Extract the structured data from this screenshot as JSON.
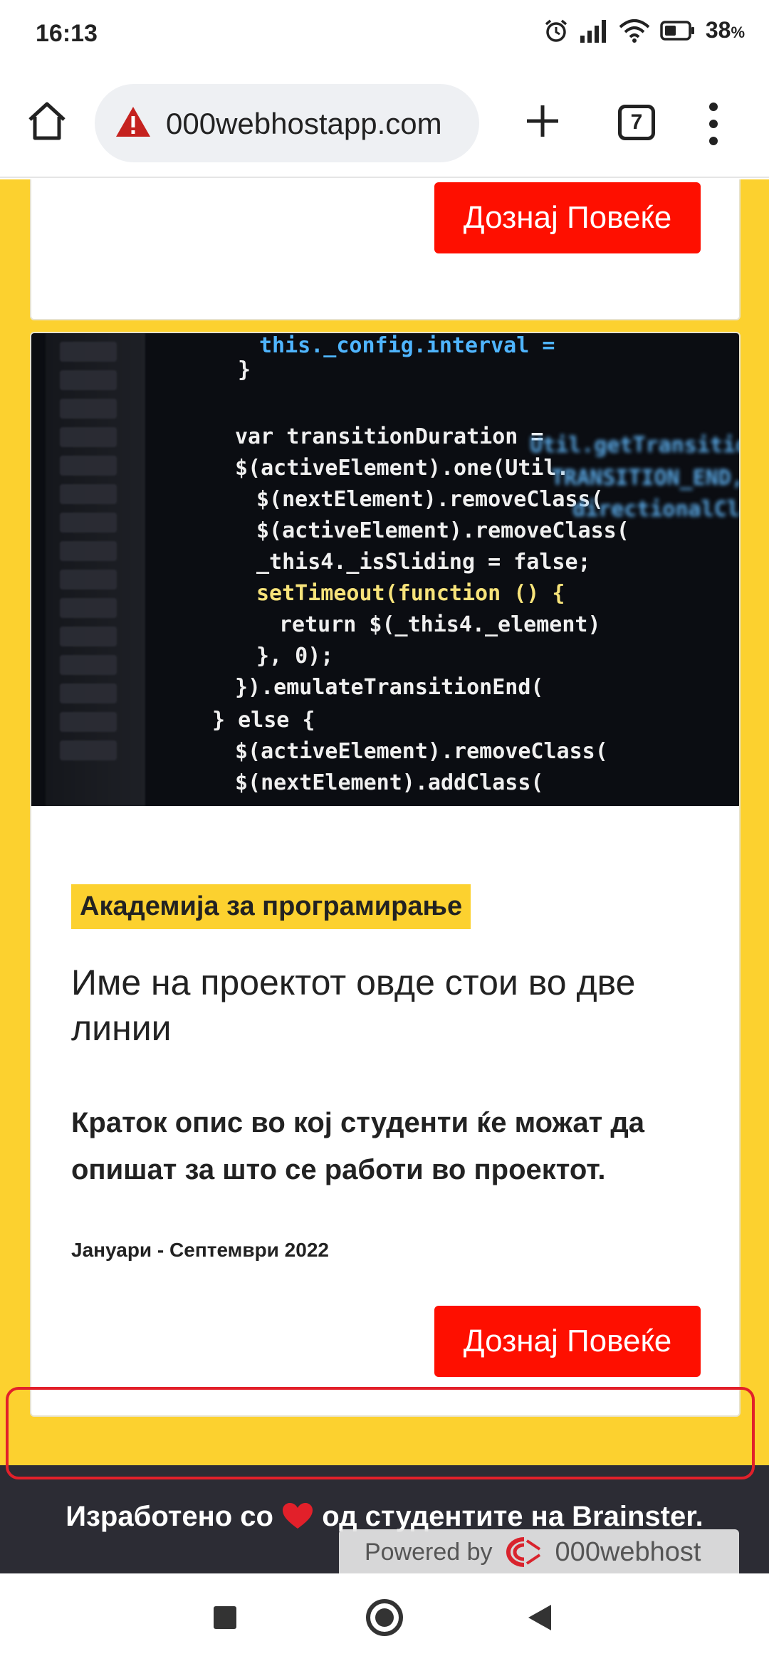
{
  "status": {
    "time": "16:13",
    "battery": "38",
    "battery_unit": "%"
  },
  "browser": {
    "url": "000webhostapp.com",
    "tab_count": "7"
  },
  "cards": {
    "top_button": "Дознај Повеќе",
    "main": {
      "tag": "Академија за програмирање",
      "title": "Име на проектот овде стои во две линии",
      "description": "Краток опис во кој студенти ќе можат да опишат за што се работи во проектот.",
      "date": "Јануари - Септември 2022",
      "button": "Дознај Повеќе"
    }
  },
  "code_image": {
    "lines": [
      "this._config.interval =",
      "}",
      "var transitionDuration =",
      "$(activeElement).one(Util.",
      "$(nextElement).removeClass(",
      "$(activeElement).removeClass(",
      "_this4._isSliding = false;",
      "setTimeout(function () {",
      "return $(_this4._element)",
      "}, 0);",
      "}).emulateTransitionEnd(",
      "} else {",
      "$(activeElement).removeClass(",
      "$(nextElement).addClass("
    ]
  },
  "footer": {
    "text_before": "Изработено со",
    "text_after": "од студентите на Brainster.",
    "powered_by": "Powered by",
    "powered_brand": "000webhost"
  },
  "colors": {
    "page_bg": "#fcd12f",
    "button": "#fe0f00",
    "footer_bg": "#2c2c34",
    "highlight": "#e2202a"
  }
}
